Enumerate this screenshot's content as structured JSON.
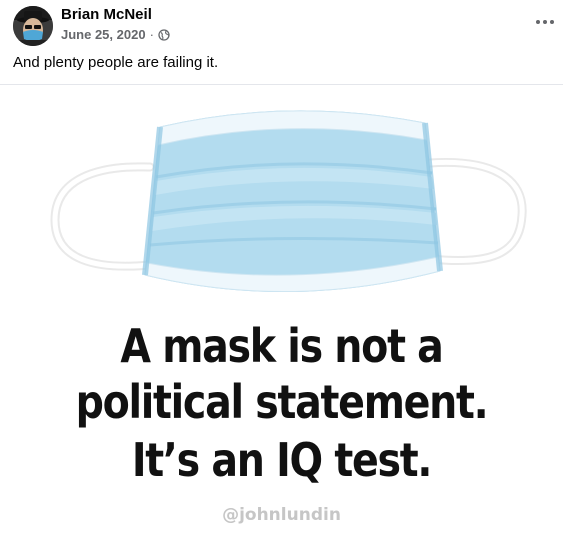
{
  "post": {
    "author": "Brian McNeil",
    "date": "June 25, 2020",
    "separator": "·",
    "privacy_icon": "globe-icon",
    "more_icon": "more-options-icon",
    "text": "And plenty people are failing it."
  },
  "image": {
    "mask_icon": "surgical-mask-icon",
    "line1": "A mask is not a",
    "line2": "political statement.",
    "line3": "It’s an IQ test.",
    "credit": "@johnlundin",
    "colors": {
      "mask_blue": "#b3dcef",
      "mask_pleat": "#9fd0e8",
      "text": "#111111",
      "credit": "#c6c6c6"
    }
  }
}
